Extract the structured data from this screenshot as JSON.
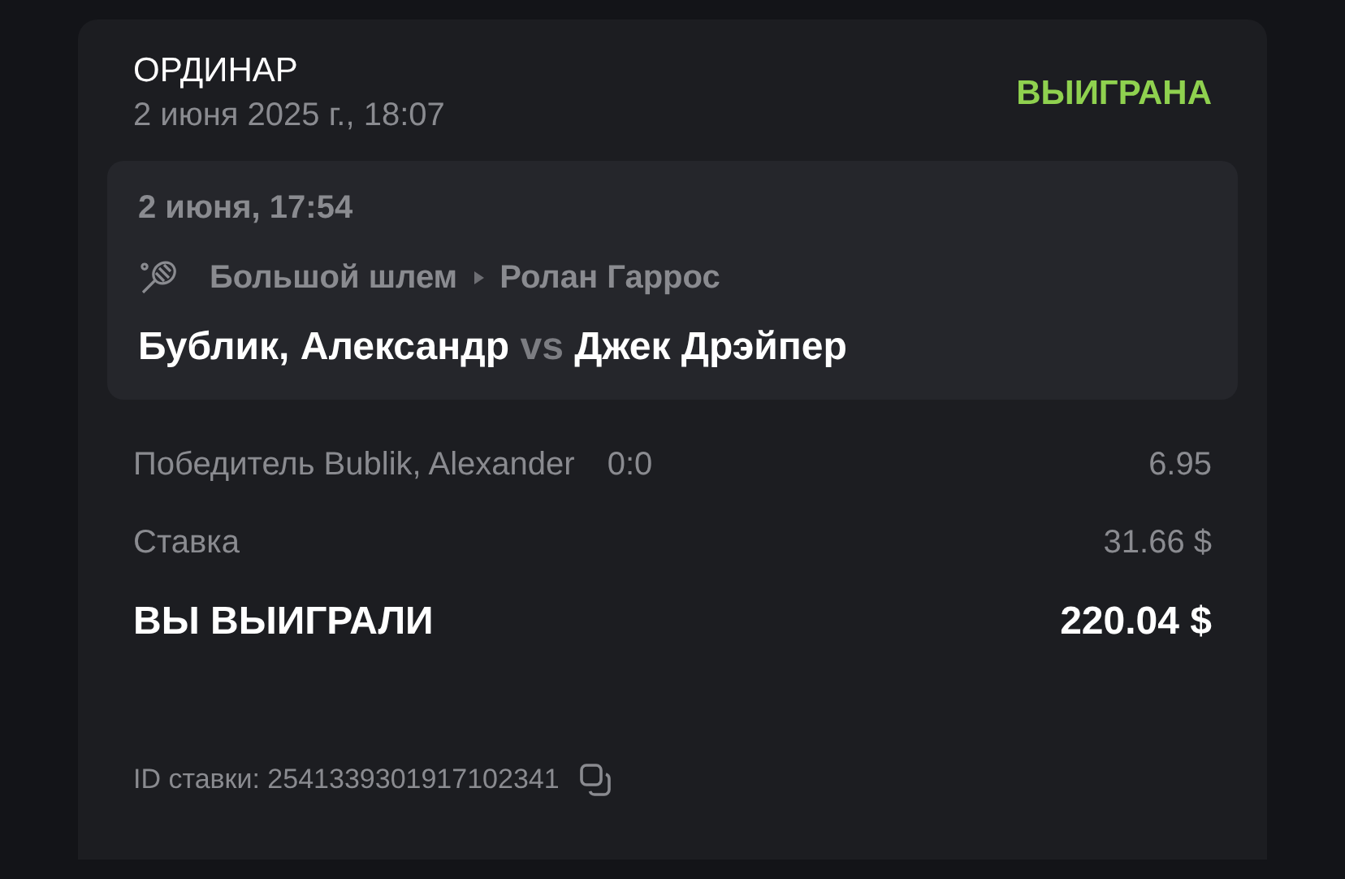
{
  "bet": {
    "type": "ОРДИНАР",
    "placed_at": "2 июня 2025 г., 18:07",
    "status": {
      "text": "ВЫИГРАНА",
      "kind": "won"
    }
  },
  "event": {
    "start": "2 июня, 17:54",
    "tournament": [
      "Большой шлем",
      "Ролан Гаррос"
    ],
    "home": "Бублик, Александр",
    "separator": "vs",
    "away": "Джек Дрэйпер"
  },
  "details": [
    {
      "kind": "plain",
      "label": "Победитель Bublik, Alexander",
      "extra": "0:0",
      "value": "6.95"
    },
    {
      "kind": "plain",
      "label": "Ставка",
      "value": "31.66 $"
    },
    {
      "kind": "total",
      "label": "ВЫ ВЫИГРАЛИ",
      "value": "220.04 $"
    }
  ],
  "bet_id": "ID ставки: 2541339301917102341"
}
